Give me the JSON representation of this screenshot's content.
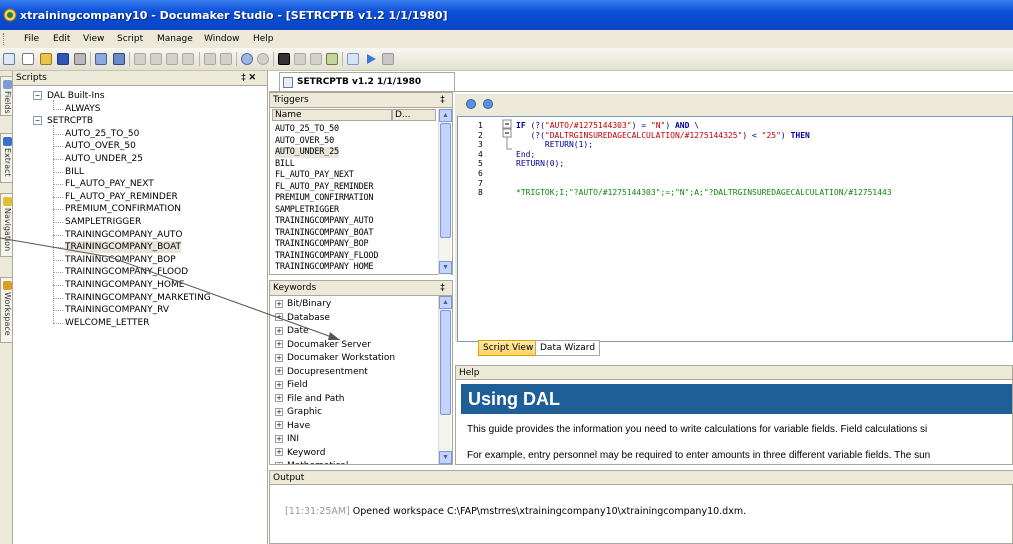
{
  "window": {
    "title": "xtrainingcompany10 - Documaker Studio - [SETRCPTB v1.2 1/1/1980]"
  },
  "menu": [
    "File",
    "Edit",
    "View",
    "Script",
    "Manage",
    "Window",
    "Help"
  ],
  "side_tabs": [
    "Fields",
    "Extract",
    "Navigation",
    "Workspace"
  ],
  "scripts_panel": {
    "title": "Scripts",
    "pin": "‡ ✕",
    "tree": [
      {
        "label": "DAL Built-Ins",
        "level": 0,
        "expander": "−"
      },
      {
        "label": "ALWAYS",
        "level": 1
      },
      {
        "label": "SETRCPTB",
        "level": 0,
        "expander": "−"
      },
      {
        "label": "AUTO_25_TO_50",
        "level": 1
      },
      {
        "label": "AUTO_OVER_50",
        "level": 1
      },
      {
        "label": "AUTO_UNDER_25",
        "level": 1
      },
      {
        "label": "BILL",
        "level": 1
      },
      {
        "label": "FL_AUTO_PAY_NEXT",
        "level": 1
      },
      {
        "label": "FL_AUTO_PAY_REMINDER",
        "level": 1
      },
      {
        "label": "PREMIUM_CONFIRMATION",
        "level": 1
      },
      {
        "label": "SAMPLETRIGGER",
        "level": 1
      },
      {
        "label": "TRAININGCOMPANY_AUTO",
        "level": 1
      },
      {
        "label": "TRAININGCOMPANY_BOAT",
        "level": 1,
        "selected": true
      },
      {
        "label": "TRAININGCOMPANY_BOP",
        "level": 1
      },
      {
        "label": "TRAININGCOMPANY_FLOOD",
        "level": 1
      },
      {
        "label": "TRAININGCOMPANY_HOME",
        "level": 1
      },
      {
        "label": "TRAININGCOMPANY_MARKETING",
        "level": 1
      },
      {
        "label": "TRAININGCOMPANY_RV",
        "level": 1
      },
      {
        "label": "WELCOME_LETTER",
        "level": 1
      }
    ]
  },
  "document_tab": {
    "label": "SETRCPTB v1.2 1/1/1980"
  },
  "triggers_panel": {
    "title": "Triggers",
    "pin": "‡",
    "columns": [
      "Name",
      "D..."
    ],
    "items": [
      "AUTO_25_TO_50",
      "AUTO_OVER_50",
      "AUTO_UNDER_25",
      "BILL",
      "FL_AUTO_PAY_NEXT",
      "FL_AUTO_PAY_REMINDER",
      "PREMIUM_CONFIRMATION",
      "SAMPLETRIGGER",
      "TRAININGCOMPANY_AUTO",
      "TRAININGCOMPANY_BOAT",
      "TRAININGCOMPANY_BOP",
      "TRAININGCOMPANY_FLOOD",
      "TRAININGCOMPANY HOME"
    ],
    "selected_item": "AUTO_UNDER_25"
  },
  "keywords_panel": {
    "title": "Keywords",
    "pin": "‡",
    "items": [
      "Bit/Binary",
      "Database",
      "Date",
      "Documaker Server",
      "Documaker Workstation",
      "Docupresentment",
      "Field",
      "File and Path",
      "Graphic",
      "Have",
      "INI",
      "Keyword",
      "Mathematical"
    ]
  },
  "editor": {
    "line_numbers": [
      "1",
      "2",
      "3",
      "4",
      "5",
      "6",
      "7",
      "8"
    ],
    "lines": [
      [
        {
          "t": "IF ",
          "c": "kw"
        },
        {
          "t": "(?(",
          "c": "plain"
        },
        {
          "t": "\"AUTO/#1275144303\"",
          "c": "str"
        },
        {
          "t": ") = ",
          "c": "plain"
        },
        {
          "t": "\"N\"",
          "c": "str"
        },
        {
          "t": ") ",
          "c": "plain"
        },
        {
          "t": "AND",
          "c": "kw"
        },
        {
          "t": " \\",
          "c": "plain"
        }
      ],
      [
        {
          "t": "   (?(",
          "c": "plain"
        },
        {
          "t": "\"DALTRGINSUREDAGECALCULATION/#1275144325\"",
          "c": "str"
        },
        {
          "t": ") < ",
          "c": "plain"
        },
        {
          "t": "\"25\"",
          "c": "str"
        },
        {
          "t": ") ",
          "c": "plain"
        },
        {
          "t": "THEN",
          "c": "kw"
        }
      ],
      [
        {
          "t": "      RETURN(1);",
          "c": "plain"
        }
      ],
      [
        {
          "t": "End;",
          "c": "plain"
        }
      ],
      [
        {
          "t": "RETURN(0);",
          "c": "plain"
        }
      ],
      [],
      [],
      [
        {
          "t": "*TRIGTOK;I;\"?AUTO/#1275144303\";=;\"N\";A;\"?DALTRGINSUREDAGECALCULATION/#12751443",
          "c": "green"
        }
      ]
    ]
  },
  "view_tabs": {
    "script_view": "Script View",
    "data_wizard": "Data Wizard"
  },
  "help": {
    "header": "Help",
    "title": "Using DAL",
    "para1": "This guide provides the information you need to write calculations for variable fields. Field calculations si",
    "para2": "For example, entry personnel may be required to enter amounts in three different variable fields. The sun"
  },
  "output": {
    "header": "Output",
    "timestamp": "[11:31:25AM]",
    "message": " Opened workspace C:\\FAP\\mstrres\\xtrainingcompany10\\xtrainingcompany10.dxm."
  },
  "colors": {
    "titlebar": "#0a4fd6",
    "help_title_bg": "#1f5f98",
    "active_view_tab": "#fcd36a"
  }
}
